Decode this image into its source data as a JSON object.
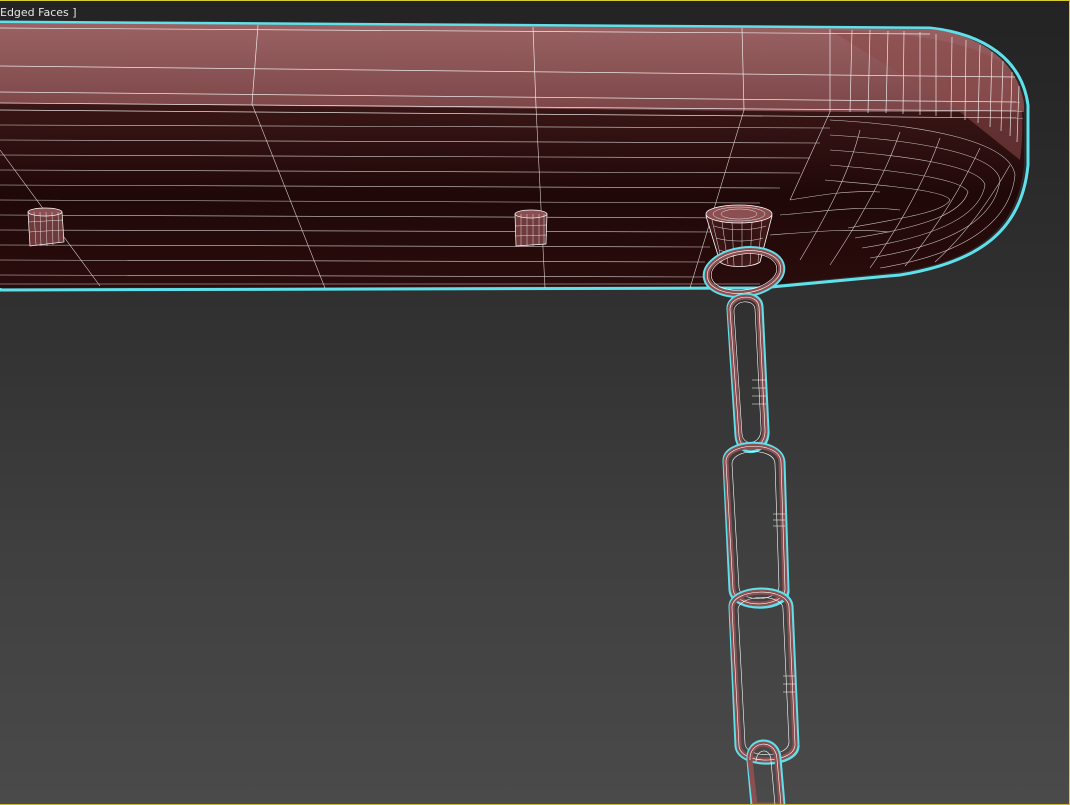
{
  "viewport": {
    "label": "Edged Faces ]",
    "frame_color": "#d8cc2c",
    "background_top": "#232323",
    "background_bottom": "#4a4a4a"
  },
  "scene": {
    "object_color": "#8b4f51",
    "wire_color": "#ffffff",
    "selection_outline_color": "#5fe0ea"
  }
}
